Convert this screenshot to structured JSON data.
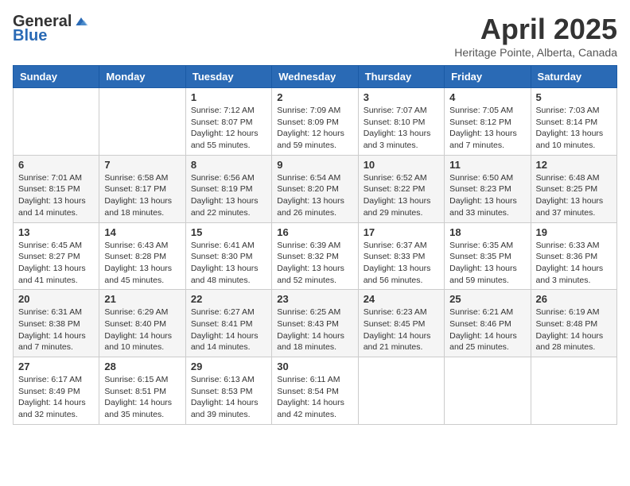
{
  "logo": {
    "general": "General",
    "blue": "Blue"
  },
  "title": "April 2025",
  "location": "Heritage Pointe, Alberta, Canada",
  "days_of_week": [
    "Sunday",
    "Monday",
    "Tuesday",
    "Wednesday",
    "Thursday",
    "Friday",
    "Saturday"
  ],
  "weeks": [
    [
      {
        "day": "",
        "info": ""
      },
      {
        "day": "",
        "info": ""
      },
      {
        "day": "1",
        "info": "Sunrise: 7:12 AM\nSunset: 8:07 PM\nDaylight: 12 hours and 55 minutes."
      },
      {
        "day": "2",
        "info": "Sunrise: 7:09 AM\nSunset: 8:09 PM\nDaylight: 12 hours and 59 minutes."
      },
      {
        "day": "3",
        "info": "Sunrise: 7:07 AM\nSunset: 8:10 PM\nDaylight: 13 hours and 3 minutes."
      },
      {
        "day": "4",
        "info": "Sunrise: 7:05 AM\nSunset: 8:12 PM\nDaylight: 13 hours and 7 minutes."
      },
      {
        "day": "5",
        "info": "Sunrise: 7:03 AM\nSunset: 8:14 PM\nDaylight: 13 hours and 10 minutes."
      }
    ],
    [
      {
        "day": "6",
        "info": "Sunrise: 7:01 AM\nSunset: 8:15 PM\nDaylight: 13 hours and 14 minutes."
      },
      {
        "day": "7",
        "info": "Sunrise: 6:58 AM\nSunset: 8:17 PM\nDaylight: 13 hours and 18 minutes."
      },
      {
        "day": "8",
        "info": "Sunrise: 6:56 AM\nSunset: 8:19 PM\nDaylight: 13 hours and 22 minutes."
      },
      {
        "day": "9",
        "info": "Sunrise: 6:54 AM\nSunset: 8:20 PM\nDaylight: 13 hours and 26 minutes."
      },
      {
        "day": "10",
        "info": "Sunrise: 6:52 AM\nSunset: 8:22 PM\nDaylight: 13 hours and 29 minutes."
      },
      {
        "day": "11",
        "info": "Sunrise: 6:50 AM\nSunset: 8:23 PM\nDaylight: 13 hours and 33 minutes."
      },
      {
        "day": "12",
        "info": "Sunrise: 6:48 AM\nSunset: 8:25 PM\nDaylight: 13 hours and 37 minutes."
      }
    ],
    [
      {
        "day": "13",
        "info": "Sunrise: 6:45 AM\nSunset: 8:27 PM\nDaylight: 13 hours and 41 minutes."
      },
      {
        "day": "14",
        "info": "Sunrise: 6:43 AM\nSunset: 8:28 PM\nDaylight: 13 hours and 45 minutes."
      },
      {
        "day": "15",
        "info": "Sunrise: 6:41 AM\nSunset: 8:30 PM\nDaylight: 13 hours and 48 minutes."
      },
      {
        "day": "16",
        "info": "Sunrise: 6:39 AM\nSunset: 8:32 PM\nDaylight: 13 hours and 52 minutes."
      },
      {
        "day": "17",
        "info": "Sunrise: 6:37 AM\nSunset: 8:33 PM\nDaylight: 13 hours and 56 minutes."
      },
      {
        "day": "18",
        "info": "Sunrise: 6:35 AM\nSunset: 8:35 PM\nDaylight: 13 hours and 59 minutes."
      },
      {
        "day": "19",
        "info": "Sunrise: 6:33 AM\nSunset: 8:36 PM\nDaylight: 14 hours and 3 minutes."
      }
    ],
    [
      {
        "day": "20",
        "info": "Sunrise: 6:31 AM\nSunset: 8:38 PM\nDaylight: 14 hours and 7 minutes."
      },
      {
        "day": "21",
        "info": "Sunrise: 6:29 AM\nSunset: 8:40 PM\nDaylight: 14 hours and 10 minutes."
      },
      {
        "day": "22",
        "info": "Sunrise: 6:27 AM\nSunset: 8:41 PM\nDaylight: 14 hours and 14 minutes."
      },
      {
        "day": "23",
        "info": "Sunrise: 6:25 AM\nSunset: 8:43 PM\nDaylight: 14 hours and 18 minutes."
      },
      {
        "day": "24",
        "info": "Sunrise: 6:23 AM\nSunset: 8:45 PM\nDaylight: 14 hours and 21 minutes."
      },
      {
        "day": "25",
        "info": "Sunrise: 6:21 AM\nSunset: 8:46 PM\nDaylight: 14 hours and 25 minutes."
      },
      {
        "day": "26",
        "info": "Sunrise: 6:19 AM\nSunset: 8:48 PM\nDaylight: 14 hours and 28 minutes."
      }
    ],
    [
      {
        "day": "27",
        "info": "Sunrise: 6:17 AM\nSunset: 8:49 PM\nDaylight: 14 hours and 32 minutes."
      },
      {
        "day": "28",
        "info": "Sunrise: 6:15 AM\nSunset: 8:51 PM\nDaylight: 14 hours and 35 minutes."
      },
      {
        "day": "29",
        "info": "Sunrise: 6:13 AM\nSunset: 8:53 PM\nDaylight: 14 hours and 39 minutes."
      },
      {
        "day": "30",
        "info": "Sunrise: 6:11 AM\nSunset: 8:54 PM\nDaylight: 14 hours and 42 minutes."
      },
      {
        "day": "",
        "info": ""
      },
      {
        "day": "",
        "info": ""
      },
      {
        "day": "",
        "info": ""
      }
    ]
  ]
}
